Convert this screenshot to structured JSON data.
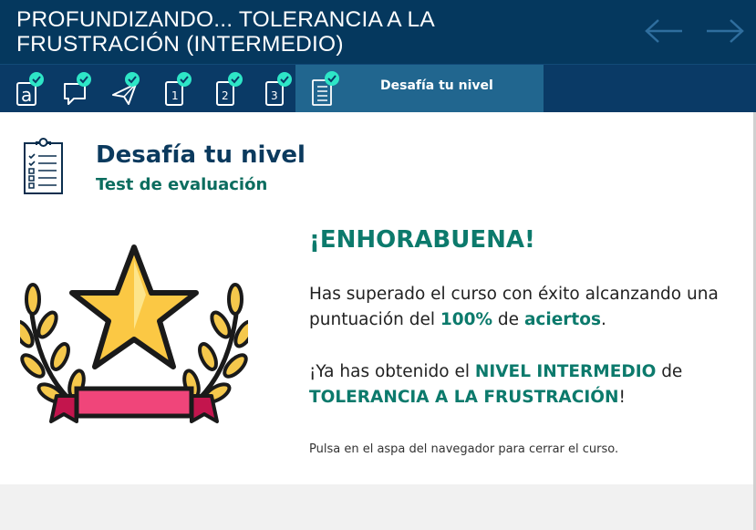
{
  "header": {
    "title": "PROFUNDIZANDO... TOLERANCIA A LA FRUSTRACIÓN (INTERMEDIO)",
    "prev_icon": "arrow-left-icon",
    "next_icon": "arrow-right-icon"
  },
  "steps": [
    {
      "icon": "intro-a-icon",
      "completed": true
    },
    {
      "icon": "chat-bubble-icon",
      "completed": true
    },
    {
      "icon": "paper-plane-icon",
      "completed": true
    },
    {
      "icon": "tablet-1-icon",
      "completed": true
    },
    {
      "icon": "tablet-2-icon",
      "completed": true
    },
    {
      "icon": "tablet-3-icon",
      "completed": true
    },
    {
      "icon": "checklist-icon",
      "completed": true,
      "active": true,
      "label": "Desafía tu nivel"
    }
  ],
  "colors": {
    "header_bg": "#05385e",
    "active_tab": "#21668f",
    "check_badge": "#2ee6c7",
    "accent_green": "#0c7a6c",
    "title_blue": "#0b3a5e"
  },
  "section": {
    "title": "Desafía tu nivel",
    "subtitle": "Test de evaluación"
  },
  "result": {
    "congrats": "¡ENHORABUENA!",
    "p1_a": "Has superado el curso con éxito alcanzando una puntuación del ",
    "p1_score": "100%",
    "p1_b": " de ",
    "p1_hits": "aciertos",
    "p1_c": ".",
    "p2_a": "¡Ya has obtenido el ",
    "p2_level": "NIVEL INTERMEDIO",
    "p2_b": " de ",
    "p2_course": "TOLERANCIA A LA FRUSTRACIÓN",
    "p2_c": "!",
    "note": "Pulsa en el aspa del navegador para cerrar el curso."
  }
}
